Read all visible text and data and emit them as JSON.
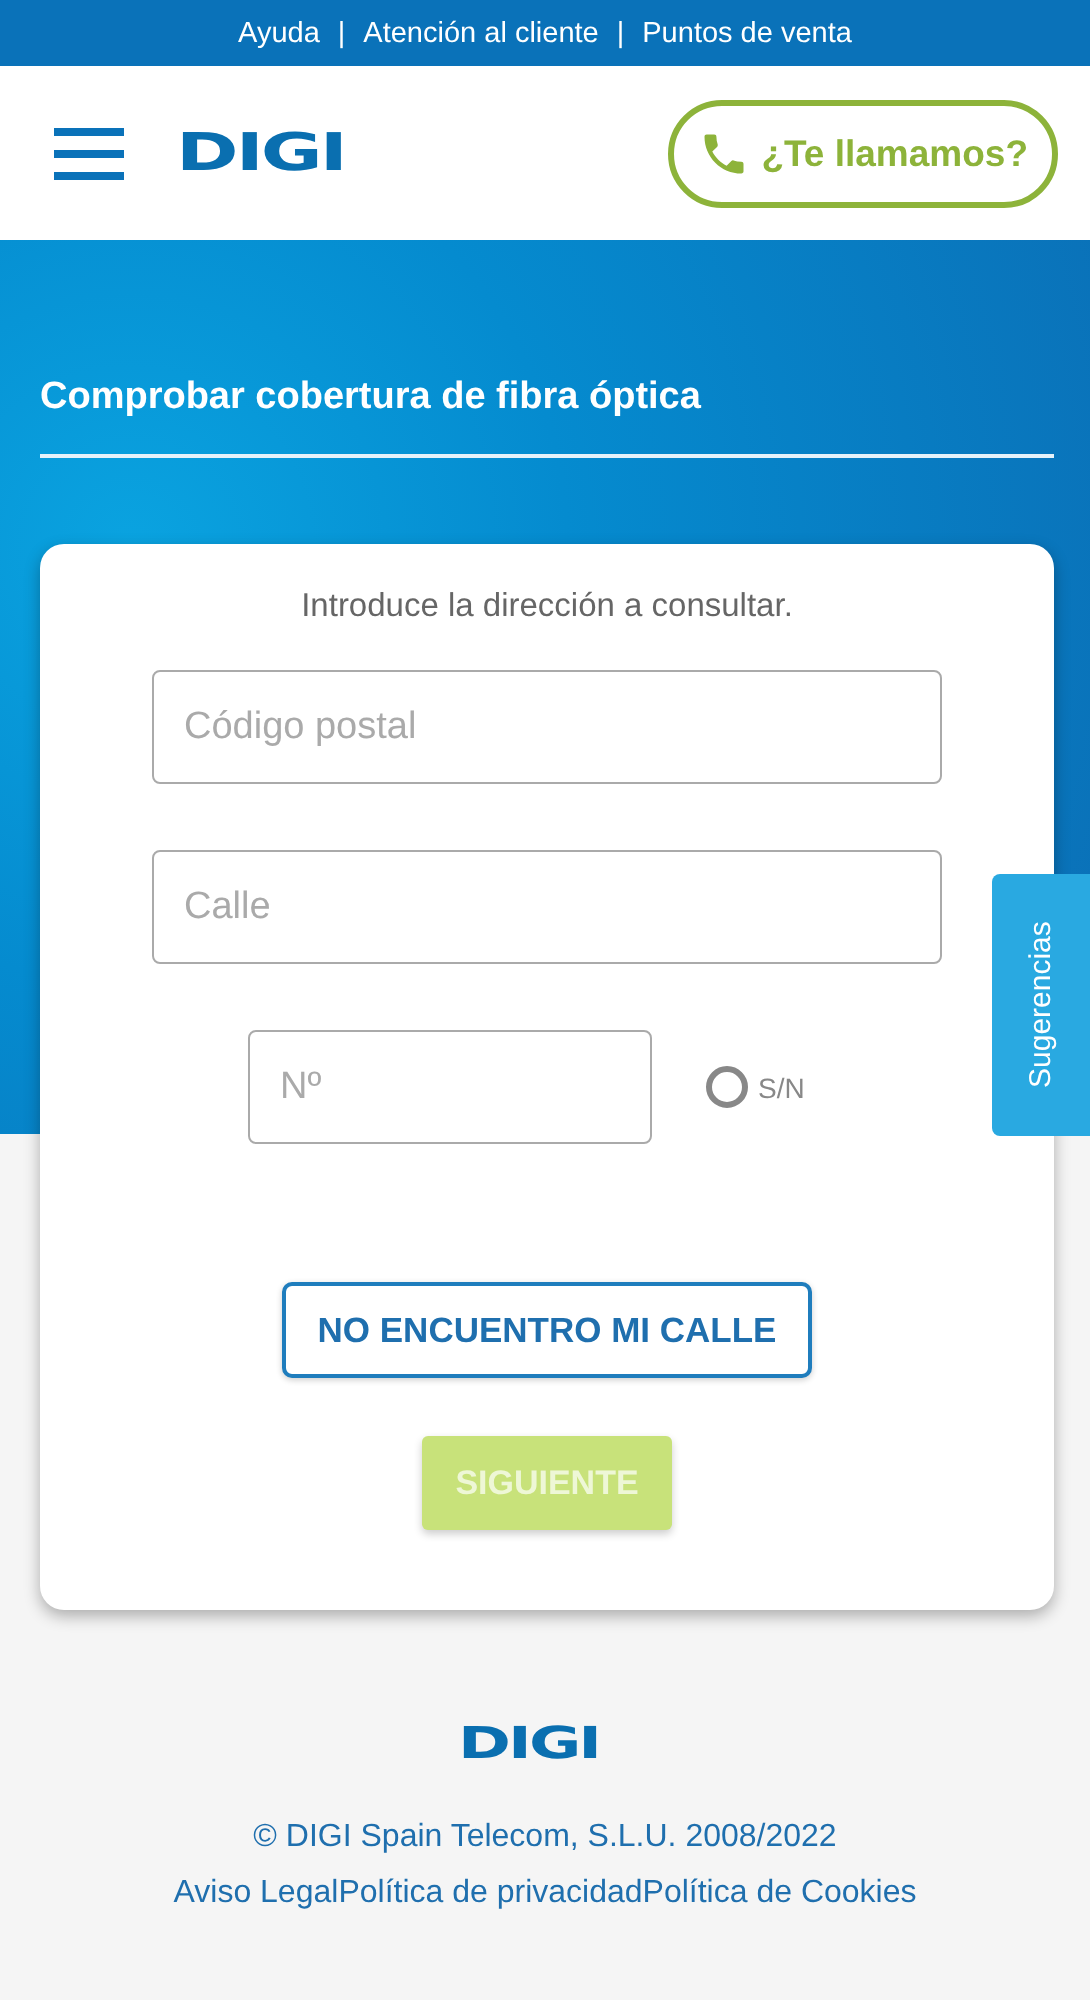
{
  "top_links": [
    "Ayuda",
    "Atención al cliente",
    "Puntos de venta"
  ],
  "top_separator": "|",
  "header": {
    "logo": "DIGI",
    "call_button": "¿Te llamamos?"
  },
  "title": "Comprobar cobertura de fibra óptica",
  "form": {
    "intro": "Introduce la dirección a consultar.",
    "postal_code": {
      "placeholder": "Código postal"
    },
    "street": {
      "placeholder": "Calle"
    },
    "number": {
      "placeholder": "Nº"
    },
    "no_number": {
      "label": "S/N",
      "selected": false
    },
    "secondary_button": "NO ENCUENTRO MI CALLE",
    "next_button": {
      "label": "SIGUIENTE",
      "disabled": true
    }
  },
  "side_tab": "Sugerencias",
  "footer": {
    "logo": "DIGI",
    "copyright": "© DIGI Spain Telecom, S.L.U. 2008/2022",
    "links": [
      "Aviso Legal",
      "Política de privacidad",
      "Política de Cookies"
    ]
  }
}
